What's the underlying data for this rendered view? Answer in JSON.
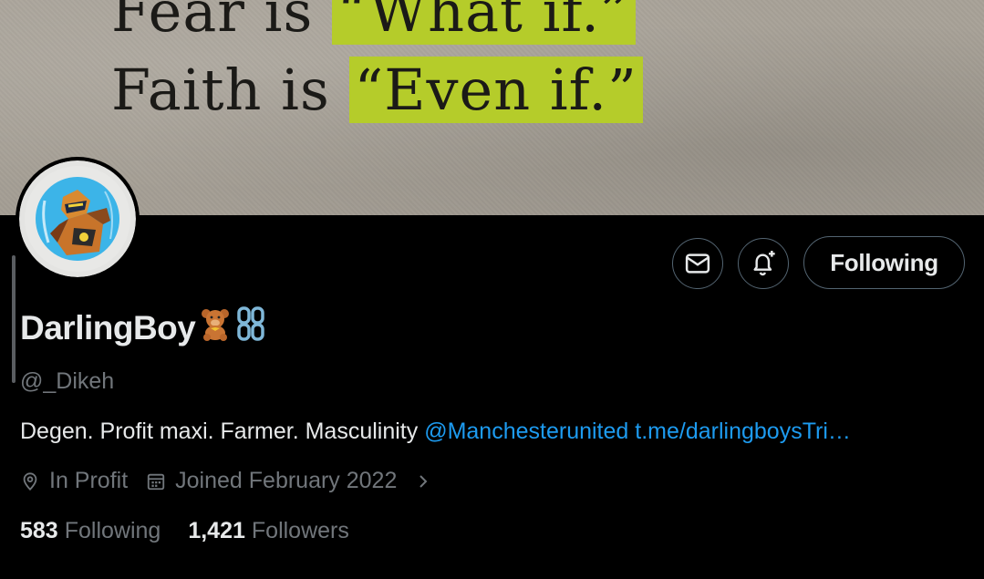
{
  "banner": {
    "quote_line1_prefix": "Fear is ",
    "quote_line1_highlight": "“What if.”",
    "quote_line2_prefix": "Faith is ",
    "quote_line2_highlight": "“Even if.”",
    "highlight_color": "#b5cc2a"
  },
  "actions": {
    "message_icon": "envelope-icon",
    "notify_icon": "bell-plus-icon",
    "following_label": "Following"
  },
  "profile": {
    "display_name": "DarlingBoy",
    "name_emojis": [
      "teddy-bear-emoji",
      "chain-link-emoji"
    ],
    "handle": "@_Dikeh",
    "bio_text": "Degen. Profit maxi. Farmer. Masculinity ",
    "bio_mention": "@Manchesterunited",
    "bio_link": "t.me/darlingboysTri…",
    "location": "In Profit",
    "joined": "Joined February 2022",
    "location_icon": "location-pin-icon",
    "calendar_icon": "calendar-icon",
    "chevron_icon": "chevron-right-icon"
  },
  "stats": {
    "following_count": "583",
    "following_label": "Following",
    "followers_count": "1,421",
    "followers_label": "Followers"
  },
  "colors": {
    "accent": "#1d9bf0",
    "muted": "#71767b",
    "text": "#e7e9ea",
    "border": "#536471"
  }
}
